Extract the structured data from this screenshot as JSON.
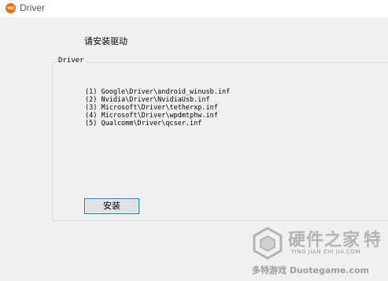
{
  "window": {
    "title": "Driver",
    "icon": "mi-logo-icon",
    "icon_text": "mi",
    "accent_color": "#ff6900"
  },
  "main": {
    "heading": "请安装驱动",
    "group": {
      "label": "Driver",
      "items": [
        "(1) Google\\Driver\\android_winusb.inf",
        "(2) Nvidia\\Driver\\NvidiaUsb.inf",
        "(3) Microsoft\\Driver\\tetherxp.inf",
        "(4) Microsoft\\Driver\\wpdmtphw.inf",
        "(5) Qualcomm\\Driver\\qcser.inf"
      ]
    },
    "install_button_label": "安装",
    "button_border_color": "#0078d7"
  },
  "watermark": {
    "main_text": "硬件之家",
    "extra_char": "特",
    "sub_text": "YING JIAN ZHI JIA.COM",
    "bottom_text": "多特游戏 Duotegame.com",
    "logo_icon": "cube-logo-icon"
  }
}
